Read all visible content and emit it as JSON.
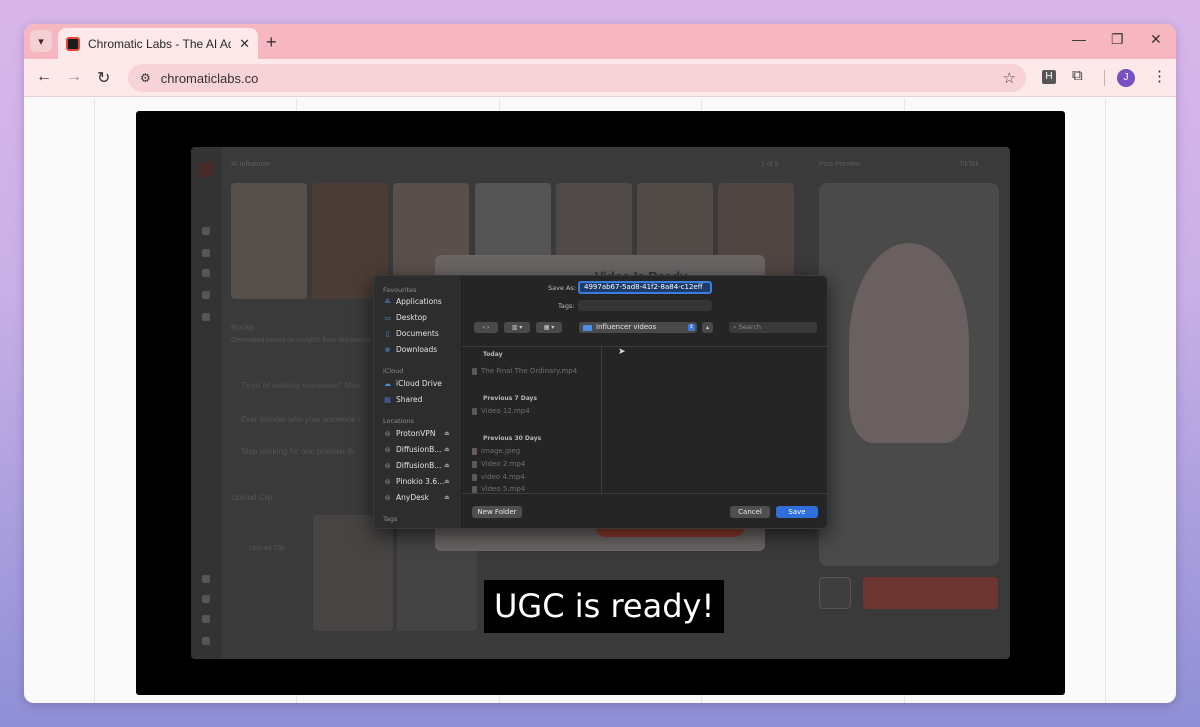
{
  "browser": {
    "tab_title": "Chromatic Labs - The AI Ad Platfo",
    "url": "chromaticlabs.co",
    "profile_initial": "J",
    "extension_label": "H"
  },
  "app_background": {
    "section_title": "AI Influencer",
    "pagination": "1 of 5",
    "preview_label": "Post Preview",
    "preview_platform": "TikTok",
    "hooks_label": "Hooks",
    "hooks_desc": "Generated based on insights from thousands of ads",
    "hook_1": "Tired of waiting someone? Mea",
    "hook_2": "Ever wonder who your someone i",
    "hook_3": "Stop working for one provider th",
    "upload_label": "Upload Clip",
    "upload_button": "Upload Clip",
    "back_dialog_title": "Video Is Ready"
  },
  "save_dialog": {
    "sidebar": {
      "favourites_title": "Favourites",
      "favourites": [
        "Applications",
        "Desktop",
        "Documents",
        "Downloads"
      ],
      "icloud_title": "iCloud",
      "icloud": [
        "iCloud Drive",
        "Shared"
      ],
      "locations_title": "Locations",
      "locations": [
        "ProtonVPN",
        "DiffusionB...",
        "DiffusionB...",
        "Pinokio 3.6...",
        "AnyDesk"
      ],
      "tags_title": "Tags"
    },
    "save_as_label": "Save As:",
    "save_as_value": "4997ab67-5ad8-41f2-8a84-c12eff",
    "tags_label": "Tags:",
    "location": "Influencer videos",
    "search_placeholder": "Search",
    "groups": [
      {
        "title": "Today",
        "files": [
          "The Final The Ordinary.mp4"
        ]
      },
      {
        "title": "Previous 7 Days",
        "files": [
          "Video 12.mp4"
        ]
      },
      {
        "title": "Previous 30 Days",
        "files": [
          "image.jpeg",
          "Video 2.mp4",
          "video 4.mp4",
          "Video 5.mp4"
        ]
      }
    ],
    "new_folder": "New Folder",
    "cancel": "Cancel",
    "save": "Save"
  },
  "caption": "UGC is ready!"
}
